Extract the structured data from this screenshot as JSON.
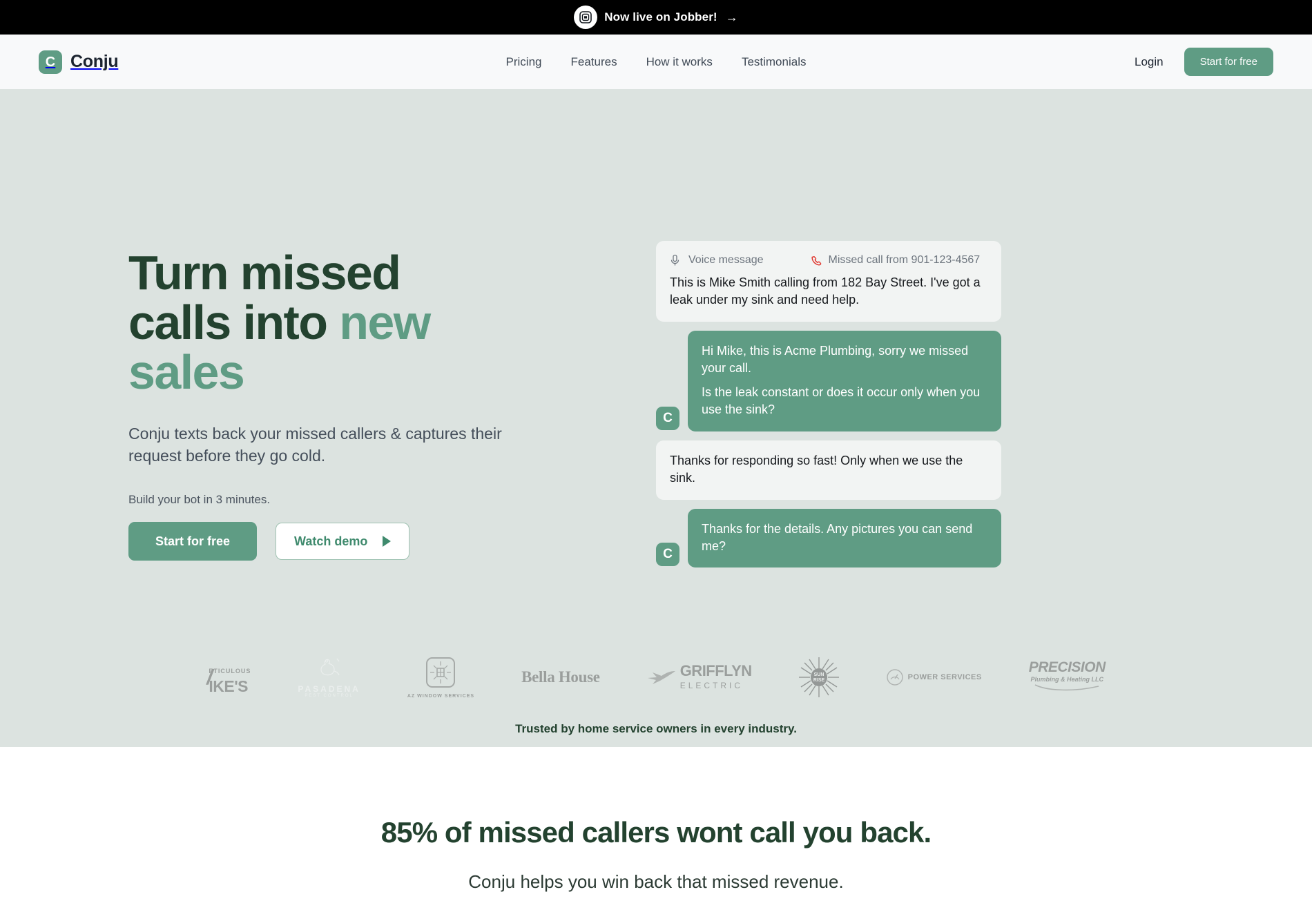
{
  "announcement": {
    "icon": "jobber-logo-icon",
    "text": "Now live on Jobber!",
    "arrow": "→"
  },
  "header": {
    "brand_mark": "C",
    "brand_name": "Conju",
    "nav": [
      {
        "label": "Pricing"
      },
      {
        "label": "Features"
      },
      {
        "label": "How it works"
      },
      {
        "label": "Testimonials"
      }
    ],
    "login_label": "Login",
    "cta_label": "Start for free"
  },
  "hero": {
    "title_part1": "Turn missed calls into ",
    "title_accent": "new sales",
    "subtitle": "Conju texts back your missed callers & captures their request before they go cold.",
    "note": "Build your bot in 3 minutes.",
    "primary_cta": "Start for free",
    "secondary_cta": "Watch demo",
    "accent_color": "#5f9c84",
    "title_color": "#23422f",
    "background_color": "#dce3e0"
  },
  "chat": {
    "voice_label": "Voice message",
    "missed_call_label": "Missed call from 901-123-4567",
    "avatar_initial": "C",
    "messages": [
      {
        "direction": "in",
        "lines": [
          "This is Mike Smith calling from 182 Bay Street. I've got a leak under my sink and need help."
        ]
      },
      {
        "direction": "out",
        "lines": [
          "Hi Mike, this is Acme Plumbing, sorry we missed your call.",
          "Is the leak constant or does it occur only when you use the sink?"
        ]
      },
      {
        "direction": "in",
        "lines": [
          "Thanks for responding so fast! Only when we use the sink."
        ]
      },
      {
        "direction": "out",
        "lines": [
          "Thanks for the details. Any pictures you can send me?"
        ]
      }
    ]
  },
  "logos": {
    "trusted_text": "Trusted by home service owners in every industry.",
    "items": [
      {
        "name": "Meticulous Mike's",
        "top": "ETICULOUS",
        "main": "IKE'S"
      },
      {
        "name": "Pasadena Pest Control",
        "main": "PASADENA",
        "sub": "PEST CONTROL"
      },
      {
        "name": "AZ Window Services",
        "sub": "AZ WINDOW SERVICES"
      },
      {
        "name": "Bella House",
        "main": "Bella House"
      },
      {
        "name": "Grifflyn Electric",
        "main": "GRIFFLYN",
        "sub": "ELECTRIC"
      },
      {
        "name": "Sun Rise",
        "main": "SUN RISE"
      },
      {
        "name": "Power Services",
        "main": "POWER SERVICES"
      },
      {
        "name": "Precision Plumbing & Heating LLC",
        "main": "PRECISION",
        "sub": "Plumbing & Heating LLC"
      }
    ]
  },
  "stats": {
    "headline": "85% of missed callers wont call you back.",
    "subline": "Conju helps you win back that missed revenue."
  }
}
